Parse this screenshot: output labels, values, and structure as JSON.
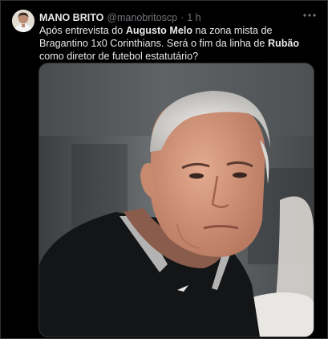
{
  "tweet": {
    "display_name": "MANO BRITO",
    "handle": "@manobritoscp",
    "separator": "·",
    "time": "1 h",
    "text": {
      "p1": "Após entrevista do ",
      "b1": "Augusto Melo",
      "p2": " na zona mista de Bragantino 1x0 Corinthians. Será o fim da linha de ",
      "b2": "Rubão",
      "p3": " como diretor de futebol estatutário?"
    }
  },
  "icons": {
    "more": "more-icon",
    "avatar": "avatar",
    "media": "photo"
  },
  "colors": {
    "background": "#000000",
    "text": "#e7e9ea",
    "secondary": "#71767b",
    "border": "#2f3336"
  }
}
